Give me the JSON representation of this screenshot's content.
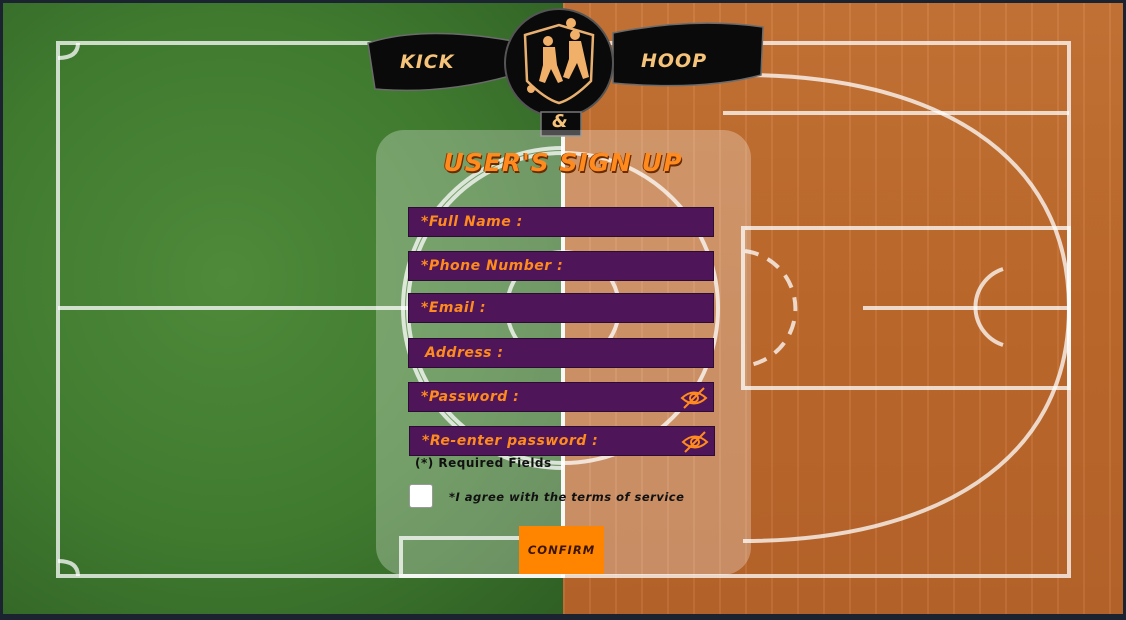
{
  "brand": {
    "left_word": "KICK",
    "right_word": "HOOP",
    "ampersand": "&"
  },
  "form": {
    "title": "USER'S SIGN UP",
    "fields": [
      {
        "label": "*Full Name :"
      },
      {
        "label": "*Phone Number :"
      },
      {
        "label": "*Email :"
      },
      {
        "label": " Address :"
      },
      {
        "label": "*Password :",
        "icon": "eye-off-icon"
      },
      {
        "label": "*Re-enter password :",
        "icon": "eye-off-icon"
      }
    ],
    "required_note": "(*) Required Fields",
    "agree_text": "*I agree with the terms of service",
    "confirm_label": "CONFIRM"
  },
  "colors": {
    "field_bg": "#4e1658",
    "accent_orange": "#ff8a1e",
    "button": "#ff8400",
    "field_label": "#ff8a1e"
  }
}
